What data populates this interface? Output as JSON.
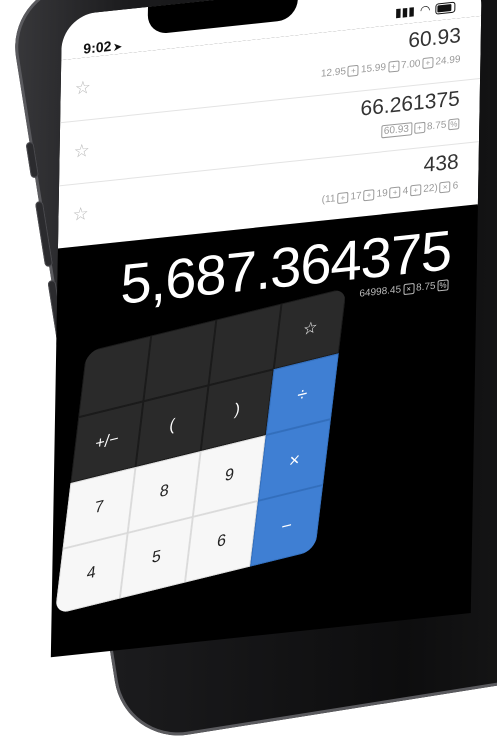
{
  "status": {
    "time": "9:02"
  },
  "history": [
    {
      "result": "60.93",
      "expr": [
        {
          "t": "12.95"
        },
        {
          "o": "+"
        },
        {
          "t": "15.99"
        },
        {
          "o": "+"
        },
        {
          "t": "7.00"
        },
        {
          "o": "+"
        },
        {
          "t": "24.99"
        }
      ]
    },
    {
      "result": "66.261375",
      "expr": [
        {
          "c": "60.93"
        },
        {
          "o": "+"
        },
        {
          "t": "8.75"
        },
        {
          "o": "%"
        }
      ]
    },
    {
      "result": "438",
      "expr": [
        {
          "t": "(11"
        },
        {
          "o": "+"
        },
        {
          "t": "17"
        },
        {
          "o": "+"
        },
        {
          "t": "19"
        },
        {
          "o": "+"
        },
        {
          "t": "4"
        },
        {
          "o": "+"
        },
        {
          "t": "22)"
        },
        {
          "o": "×"
        },
        {
          "t": "6"
        }
      ]
    }
  ],
  "display": {
    "value": "5,687.364375",
    "expr": [
      {
        "t": "64998.45"
      },
      {
        "o": "×"
      },
      {
        "t": "8.75"
      },
      {
        "o": "%"
      }
    ]
  },
  "keypad": {
    "keys": [
      {
        "label": "",
        "kind": "func",
        "name": "key-blank-1"
      },
      {
        "label": "",
        "kind": "func",
        "name": "key-blank-2"
      },
      {
        "label": "",
        "kind": "func",
        "name": "key-blank-3"
      },
      {
        "label": "☆",
        "kind": "func",
        "name": "key-favorite"
      },
      {
        "label": "+/−",
        "kind": "func",
        "name": "key-negate"
      },
      {
        "label": "(",
        "kind": "func",
        "name": "key-open-paren"
      },
      {
        "label": ")",
        "kind": "func",
        "name": "key-close-paren"
      },
      {
        "label": "÷",
        "kind": "opk",
        "name": "key-divide"
      },
      {
        "label": "7",
        "kind": "num",
        "name": "key-7"
      },
      {
        "label": "8",
        "kind": "num",
        "name": "key-8"
      },
      {
        "label": "9",
        "kind": "num",
        "name": "key-9"
      },
      {
        "label": "×",
        "kind": "opk",
        "name": "key-multiply"
      },
      {
        "label": "4",
        "kind": "num",
        "name": "key-4"
      },
      {
        "label": "5",
        "kind": "num",
        "name": "key-5"
      },
      {
        "label": "6",
        "kind": "num",
        "name": "key-6"
      },
      {
        "label": "−",
        "kind": "opk",
        "name": "key-minus"
      }
    ]
  },
  "colors": {
    "accent": "#3f7fd3",
    "display_bg": "#000000",
    "history_bg": "#ffffff"
  },
  "icons": {
    "star": "star-icon",
    "location": "location-arrow-icon",
    "wifi": "wifi-icon",
    "battery": "battery-icon",
    "signal": "signal-icon"
  }
}
